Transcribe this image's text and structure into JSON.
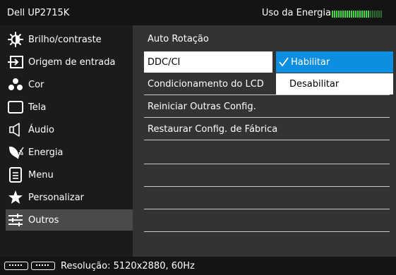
{
  "header": {
    "title": "Dell UP2715K",
    "energy_label": "Uso da Energia",
    "energy_meter": {
      "filled": 18,
      "total": 24
    }
  },
  "sidebar": {
    "items": [
      {
        "label": "Brilho/contraste",
        "icon": "brightness-icon"
      },
      {
        "label": "Origem de entrada",
        "icon": "input-source-icon"
      },
      {
        "label": "Cor",
        "icon": "color-icon"
      },
      {
        "label": "Tela",
        "icon": "display-icon"
      },
      {
        "label": "Áudio",
        "icon": "speaker-icon"
      },
      {
        "label": "Energia",
        "icon": "energy-leaf-icon"
      },
      {
        "label": "Menu",
        "icon": "menu-icon"
      },
      {
        "label": "Personalizar",
        "icon": "star-icon"
      },
      {
        "label": "Outros",
        "icon": "sliders-icon"
      }
    ],
    "selected": "Outros"
  },
  "content": {
    "items": [
      {
        "label": "Auto Rotação"
      },
      {
        "label": "DDC/CI"
      },
      {
        "label": "Condicionamento do LCD"
      },
      {
        "label": "Reiniciar Outras Config."
      },
      {
        "label": "Restaurar Config. de Fábrica"
      }
    ],
    "active": "DDC/CI"
  },
  "submenu": {
    "options": [
      {
        "label": "Habilitar",
        "selected": true
      },
      {
        "label": "Desabilitar",
        "selected": false
      }
    ]
  },
  "status": {
    "resolution": "Resolução: 5120x2880, 60Hz"
  },
  "colors": {
    "accent": "#0b8fde",
    "meter_filled": "#47d94a",
    "meter_empty": "#2d6d32"
  }
}
